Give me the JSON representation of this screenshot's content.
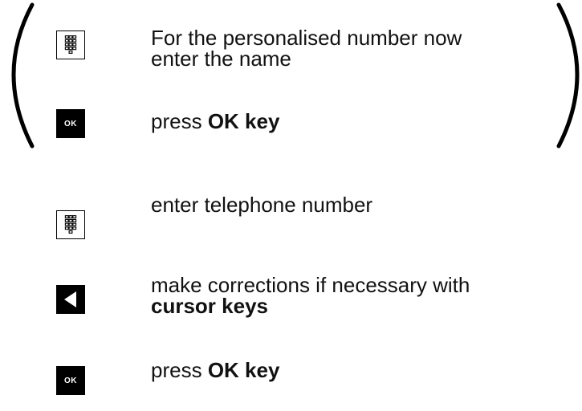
{
  "steps": [
    {
      "icon": "keypad-icon",
      "line1": "For the personalised number now",
      "line2": "enter the name"
    },
    {
      "icon": "ok-key-icon",
      "ok_label": "OK",
      "prefix": "press ",
      "bold": "OK key"
    },
    {
      "icon": "keypad-icon",
      "text": "enter telephone number"
    },
    {
      "icon": "cursor-left-key-icon",
      "line1": "make corrections if necessary with",
      "bold": "cursor keys"
    },
    {
      "icon": "ok-key-icon",
      "ok_label": "OK",
      "prefix": "press ",
      "bold": "OK key"
    }
  ]
}
